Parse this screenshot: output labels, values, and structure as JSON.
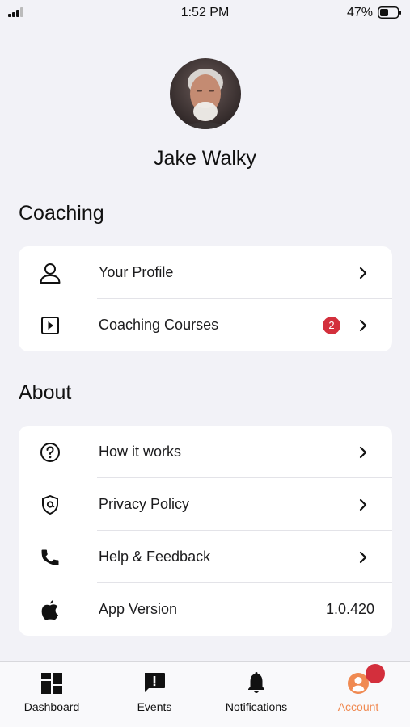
{
  "status_bar": {
    "time": "1:52 PM",
    "battery": "47%"
  },
  "profile": {
    "name": "Jake Walky"
  },
  "coaching": {
    "title": "Coaching",
    "items": [
      {
        "label": "Your Profile",
        "icon": "person-icon"
      },
      {
        "label": "Coaching Courses",
        "icon": "play-square-icon",
        "badge": "2"
      }
    ]
  },
  "about": {
    "title": "About",
    "items": [
      {
        "label": "How it works",
        "icon": "question-circle-icon"
      },
      {
        "label": "Privacy Policy",
        "icon": "shield-icon"
      },
      {
        "label": "Help & Feedback",
        "icon": "phone-icon"
      },
      {
        "label": "App Version",
        "icon": "apple-icon",
        "value": "1.0.420"
      }
    ]
  },
  "tabs": [
    {
      "label": "Dashboard",
      "icon": "dashboard-icon"
    },
    {
      "label": "Events",
      "icon": "alert-message-icon"
    },
    {
      "label": "Notifications",
      "icon": "bell-icon"
    },
    {
      "label": "Account",
      "icon": "account-icon",
      "active": true
    }
  ],
  "colors": {
    "accent": "#f08a52",
    "badge": "#d32f3c",
    "background": "#f2f2f7"
  }
}
